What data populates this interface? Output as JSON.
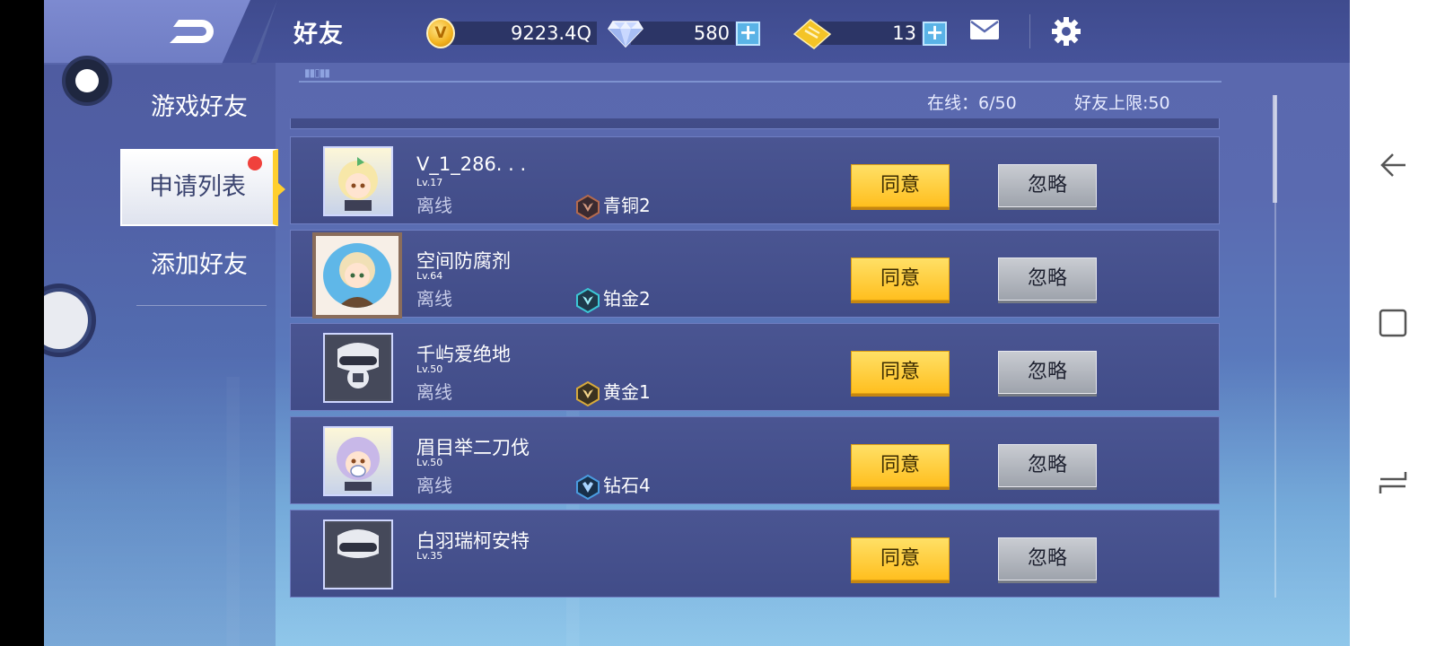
{
  "header": {
    "title": "好友",
    "gold": {
      "icon": "gold-coin-icon",
      "value": "9223.4Q",
      "glyph": "V"
    },
    "gems": {
      "icon": "diamond-gem-icon",
      "value": "580",
      "plus": "+"
    },
    "tickets": {
      "icon": "ticket-icon",
      "value": "13",
      "plus": "+"
    },
    "mail_icon": "mail-icon",
    "settings_icon": "gear-icon"
  },
  "sidebar": {
    "items": [
      {
        "label": "游戏好友",
        "active": false
      },
      {
        "label": "申请列表",
        "active": true,
        "has_badge": true
      },
      {
        "label": "添加好友",
        "active": false
      }
    ]
  },
  "list_header": {
    "online": "在线：6/50",
    "limit": "好友上限:50"
  },
  "requests": [
    {
      "name": "V_1_286. . .",
      "level": "Lv.17",
      "status": "离线",
      "rank": "青铜2",
      "rank_color": "#b46a4e",
      "avatar": "girl-green-bow",
      "agree": "同意",
      "ignore": "忽略"
    },
    {
      "name": "空间防腐剂",
      "level": "Lv.64",
      "status": "离线",
      "rank": "铂金2",
      "rank_color": "#3cc8d6",
      "avatar": "boy-framed",
      "agree": "同意",
      "ignore": "忽略"
    },
    {
      "name": "千屿爱绝地",
      "level": "Lv.50",
      "status": "离线",
      "rank": "黄金1",
      "rank_color": "#d6a93c",
      "avatar": "gas-mask",
      "agree": "同意",
      "ignore": "忽略"
    },
    {
      "name": "眉目举二刀伐",
      "level": "Lv.50",
      "status": "离线",
      "rank": "钻石4",
      "rank_color": "#4a9ce0",
      "avatar": "girl-mask",
      "agree": "同意",
      "ignore": "忽略"
    },
    {
      "name": "白羽瑞柯安特",
      "level": "Lv.35",
      "status": "",
      "rank": "",
      "rank_color": "#b46a4e",
      "avatar": "gas-mask",
      "agree": "同意",
      "ignore": "忽略"
    }
  ],
  "system_nav": {
    "back_icon": "back-arrow-icon",
    "recents_icon": "recents-icon",
    "home_icon": "home-icon"
  }
}
